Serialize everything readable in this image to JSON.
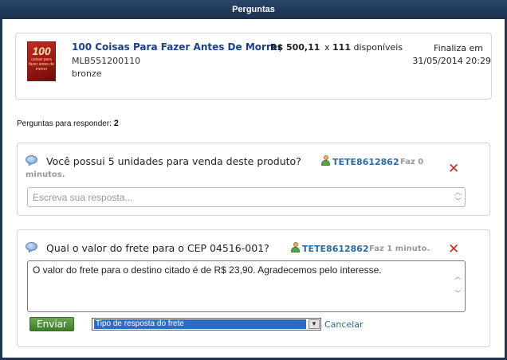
{
  "window": {
    "title": "Perguntas"
  },
  "product": {
    "title": "100 Coisas Para Fazer Antes De Morrer",
    "id": "MLB551200110",
    "listing_type": "bronze",
    "price": "R$ 500,11",
    "qty_prefix": "x",
    "qty_value": "111",
    "qty_suffix": "disponíveis",
    "ends_label": "Finaliza em",
    "ends_date": "31/05/2014 20:29",
    "thumb_text_big": "100",
    "thumb_text_small": "coisas para fazer antes de morrer"
  },
  "pending": {
    "label": "Perguntas para responder:",
    "count": "2"
  },
  "questions": [
    {
      "text": "Você possui 5 unidades para venda deste produto?",
      "user": "TETE8612862",
      "ago_line1": "Faz 0",
      "ago_line2": "minutos.",
      "answer_placeholder": "Escreva sua resposta...",
      "answer_value": ""
    },
    {
      "text": "Qual o valor do frete para o CEP 04516-001?",
      "user": "TETE8612862",
      "ago_line1": "Faz 1 minuto.",
      "answer_value": "O valor do frete para o destino citado é de R$ 23,90. Agradecemos pelo interesse.",
      "send_label": "Enviar",
      "response_type_selected": "Tipo de resposta do frete",
      "cancel_label": "Cancelar"
    }
  ],
  "icons": {
    "bubble": "speech-bubble-icon",
    "user": "user-icon",
    "delete": "delete-x-icon",
    "delete_glyph": "✕"
  },
  "colors": {
    "titlebar": "#1f3552",
    "link": "#17408b",
    "delete": "#c8281e",
    "send": "#4f8f38"
  }
}
